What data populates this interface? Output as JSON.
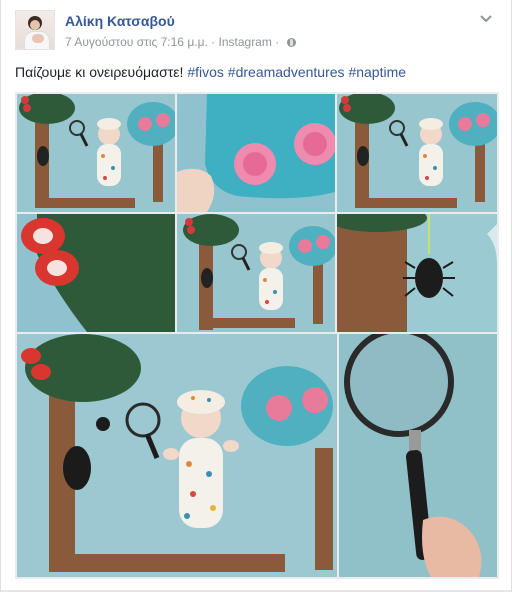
{
  "post": {
    "author": "Αλίκη Κατσαβού",
    "date": "7 Αυγούστου στις 7:16 μ.μ.",
    "separator": "·",
    "source": "Instagram",
    "privacy_icon": "globe-icon",
    "menu_icon": "chevron-down-icon",
    "text": "Παίζουμε κι ονειρευόμαστε!",
    "hashtags": [
      "#fivos",
      "#dreamadventures",
      "#naptime"
    ]
  },
  "colors": {
    "link": "#365899",
    "meta": "#90949c",
    "blanket": "#8fc2ce",
    "tree_top_green": "#2e5a3a",
    "tree_top_teal": "#4fb0c0",
    "trunk": "#8a5a3a",
    "pink": "#e87a9a"
  },
  "gallery": {
    "photos": [
      {
        "id": "photo-1",
        "scene": "baby-under-trees"
      },
      {
        "id": "photo-2",
        "scene": "teal-tree-pink-flowers"
      },
      {
        "id": "photo-3",
        "scene": "baby-under-trees"
      },
      {
        "id": "photo-4",
        "scene": "butterfly-closeup"
      },
      {
        "id": "photo-5",
        "scene": "baby-under-trees"
      },
      {
        "id": "photo-6",
        "scene": "tree-with-spider"
      },
      {
        "id": "photo-7",
        "scene": "baby-under-trees-large"
      },
      {
        "id": "photo-8",
        "scene": "magnifying-glass"
      }
    ]
  }
}
